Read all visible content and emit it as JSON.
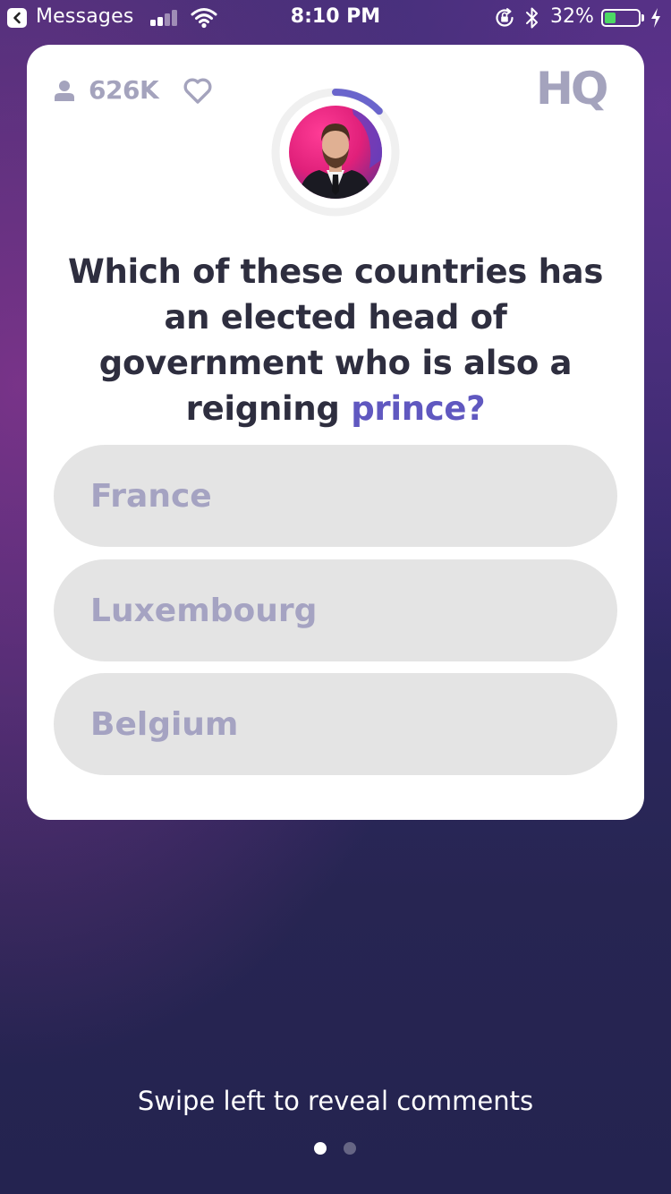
{
  "status_bar": {
    "back_label": "Messages",
    "time": "8:10 PM",
    "battery_percent_label": "32%",
    "battery_level": 0.32,
    "icons": [
      "back-arrow-icon",
      "cellular-signal-icon",
      "wifi-icon",
      "rotation-lock-icon",
      "bluetooth-icon",
      "battery-icon",
      "charging-bolt-icon"
    ]
  },
  "card": {
    "viewer_count": "626K",
    "logo": "HQ",
    "timer_progress": 0.13,
    "question_text": "Which of these countries has an elected head of government who is also a reigning ",
    "question_highlight": "prince?",
    "answers": [
      {
        "label": "France"
      },
      {
        "label": "Luxembourg"
      },
      {
        "label": "Belgium"
      }
    ]
  },
  "footer": {
    "swipe_hint": "Swipe left to reveal comments",
    "page_count": 2,
    "active_page": 1
  },
  "colors": {
    "accent": "#6058c0",
    "timer_ring": "#6a65cc",
    "answer_bg": "#e4e4e4",
    "answer_text": "#a5a3c2",
    "question_text": "#2e2e3f",
    "card_icon": "#a4a3bd",
    "background_top": "#3b2f74",
    "background_bottom": "#242350"
  }
}
